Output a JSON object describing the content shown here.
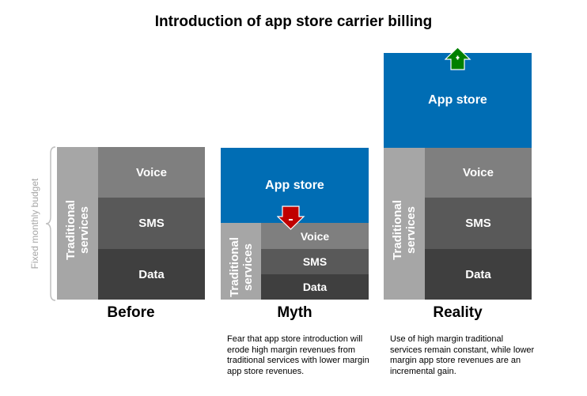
{
  "title": "Introduction of app store carrier billing",
  "budget_label": "Fixed monthly budget",
  "colors": {
    "app_store": "#006db4",
    "traditional": "#a6a6a6",
    "voice": "#7f7f7f",
    "sms": "#595959",
    "data": "#3f3f3f",
    "decrease_arrow": "#c00000",
    "increase_arrow": "#008000"
  },
  "columns": [
    {
      "name": "Before",
      "traditional_label_line1": "Traditional",
      "traditional_label_line2": "services",
      "segments": {
        "voice": "Voice",
        "sms": "SMS",
        "data": "Data"
      }
    },
    {
      "name": "Myth",
      "app_store": "App store",
      "indicator": "-",
      "traditional_label_line1": "Traditional",
      "traditional_label_line2": "services",
      "segments": {
        "voice": "Voice",
        "sms": "SMS",
        "data": "Data"
      },
      "description": "Fear that app store introduction will erode high margin revenues from traditional services with lower margin app store revenues."
    },
    {
      "name": "Reality",
      "app_store": "App store",
      "indicator": "+",
      "traditional_label_line1": "Traditional",
      "traditional_label_line2": "services",
      "segments": {
        "voice": "Voice",
        "sms": "SMS",
        "data": "Data"
      },
      "description": "Use of high margin traditional services remain constant, while lower margin app store revenues are an incremental gain."
    }
  ]
}
